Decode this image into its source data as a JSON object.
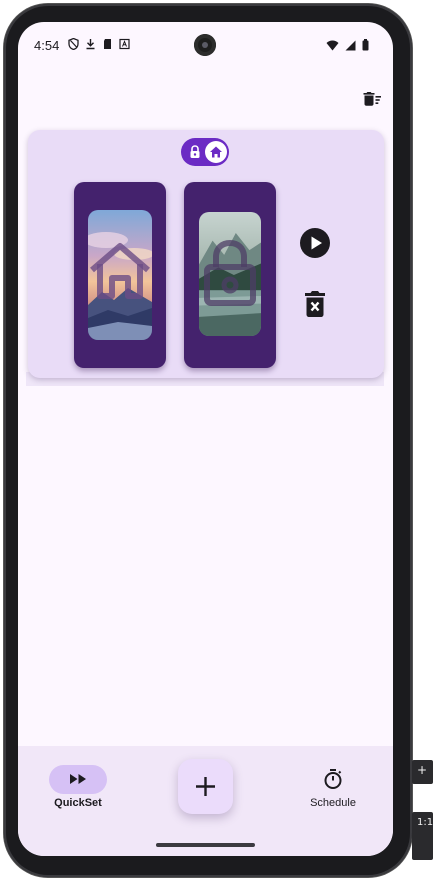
{
  "status_bar": {
    "time": "4:54",
    "left_icons": [
      "shield-icon",
      "download-icon",
      "sim-card-icon",
      "font-a-icon"
    ],
    "right_icons": [
      "wifi-icon",
      "signal-icon",
      "battery-icon"
    ]
  },
  "toolbar": {
    "clear_all_icon": "delete-sweep-icon"
  },
  "wallpaper_pair": {
    "mode_chip_icons": [
      "lock-icon",
      "home-icon"
    ],
    "home_screen_overlay_icon": "home-icon",
    "lock_screen_overlay_icon": "lock-icon",
    "play_icon": "play-circle-icon",
    "delete_icon": "delete-forever-icon"
  },
  "bottom_nav": {
    "items": [
      {
        "label": "QuickSet",
        "icon": "fast-forward-icon",
        "active": true
      },
      {
        "label": "Schedule",
        "icon": "timer-icon",
        "active": false
      }
    ],
    "fab_icon": "plus-icon"
  },
  "colors": {
    "background": "#fdf7ff",
    "card": "#e9dcf7",
    "chip": "#6b2bc4",
    "phone_frame": "#44226d",
    "nav_bar": "#f1e7f8",
    "nav_active_pill": "#d6c1f5"
  },
  "side_panel": {
    "zoom_label": "1:1"
  }
}
